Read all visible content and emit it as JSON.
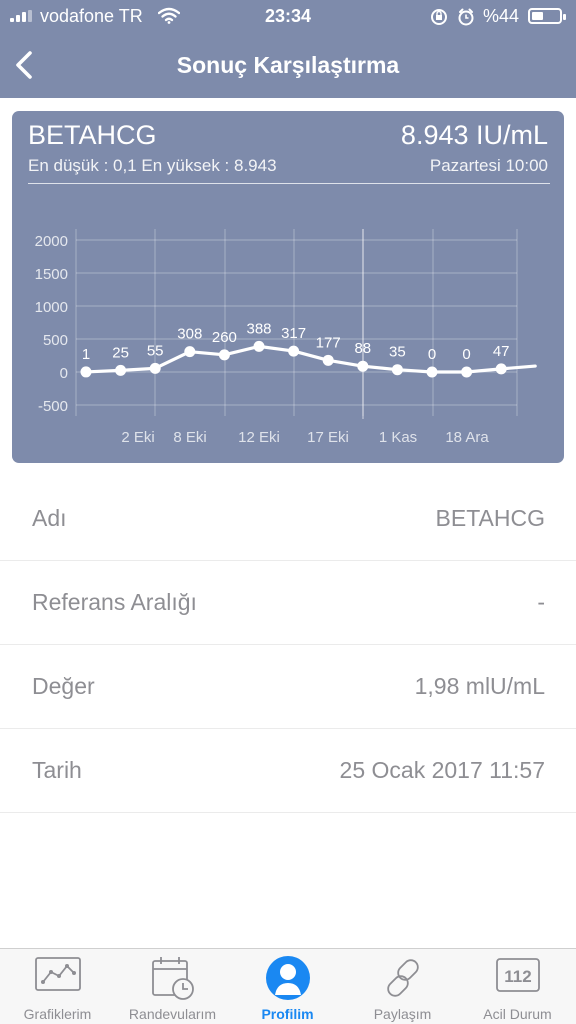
{
  "status_bar": {
    "carrier": "vodafone TR",
    "time": "23:34",
    "battery_text": "%44",
    "battery_level": 0.44,
    "icons": [
      "signal-icon",
      "wifi-icon",
      "orientation-lock-icon",
      "alarm-icon",
      "battery-icon"
    ]
  },
  "nav": {
    "title": "Sonuç Karşılaştırma",
    "back_icon": "chevron-left-icon"
  },
  "card": {
    "name": "BETAHCG",
    "value": "8.943 IU/mL",
    "minmax": "En düşük : 0,1 En yüksek : 8.943",
    "date": "Pazartesi 10:00"
  },
  "chart_data": {
    "type": "line",
    "y_ticks": [
      "2000",
      "1500",
      "1000",
      "500",
      "0",
      "-500"
    ],
    "ylim": [
      -500,
      2000
    ],
    "x_tick_labels": [
      "2 Eki",
      "8 Eki",
      "12 Eki",
      "17 Eki",
      "1 Kas",
      "18 Ara"
    ],
    "values": [
      1,
      25,
      55,
      308,
      260,
      388,
      317,
      177,
      88,
      35,
      0,
      0,
      47
    ],
    "point_labels": [
      "1",
      "25",
      "55",
      "308",
      "260",
      "388",
      "317",
      "177",
      "88",
      "35",
      "0",
      "0",
      "47"
    ],
    "grid": true,
    "line_color": "#ffffff"
  },
  "details": [
    {
      "label": "Adı",
      "value": "BETAHCG"
    },
    {
      "label": "Referans Aralığı",
      "value": "-"
    },
    {
      "label": "Değer",
      "value": "1,98 mlU/mL"
    },
    {
      "label": "Tarih",
      "value": "25 Ocak 2017 11:57"
    }
  ],
  "tabs": [
    {
      "label": "Grafiklerim",
      "icon": "chart-icon",
      "active": false
    },
    {
      "label": "Randevularım",
      "icon": "calendar-clock-icon",
      "active": false
    },
    {
      "label": "Profilim",
      "icon": "profile-icon",
      "active": true
    },
    {
      "label": "Paylaşım",
      "icon": "share-link-icon",
      "active": false
    },
    {
      "label": "Acil Durum",
      "icon": "emergency-112-icon",
      "active": false
    }
  ],
  "colors": {
    "header": "#7e8bab",
    "accent": "#1a88f2",
    "inactive": "#8e8e93"
  }
}
